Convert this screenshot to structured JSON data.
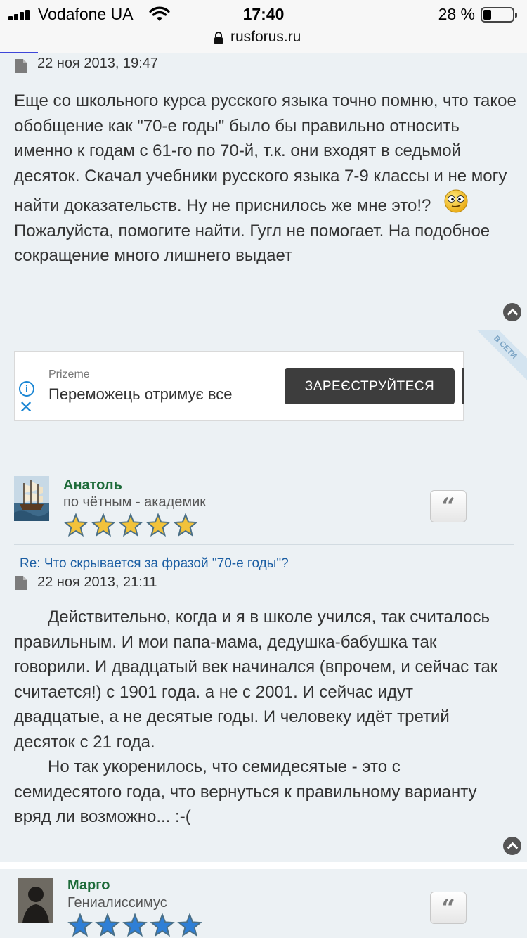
{
  "status_bar": {
    "carrier": "Vodafone UA",
    "time": "17:40",
    "battery_percent": "28 %",
    "battery_level": 0.28
  },
  "address_bar": {
    "url": "rusforus.ru"
  },
  "post1": {
    "date": "22 ноя 2013, 19:47",
    "text_before_emoji": "Еще со школьного курса русского языка точно помню, что такое обобщение как \"70-е годы\" было бы правильно относить именно к годам с 61-го по 70-й, т.к. они входят в седьмой десяток. Скачал учебники русского языка 7-9 классы и не могу найти доказательств. Ну не приснилось же мне это!?",
    "text_after_emoji": "Пожалуйста, помогите найти. Гугл не помогает. На подобное сокращение много лишнего выдает"
  },
  "ad": {
    "brand": "Prizeme",
    "headline": "Переможець отримує все",
    "cta": "ЗАРЕЄСТРУЙТЕСЯ",
    "corner_label": "В СЕТИ"
  },
  "post2": {
    "author_name": "Анатоль",
    "author_rank": "по чётным - академик",
    "rating_stars": 5,
    "subject": "Re: Что скрывается за фразой \"70-е годы\"?",
    "date": "22 ноя 2013, 21:11",
    "paragraph1": "Действительно, когда и я в школе учился, так считалось правильным. И мои папа-мама, дедушка-бабушка так говорили. И двадцатый век начинался (впрочем, и сейчас так считается!) с 1901 года. а не с 2001. И сейчас идут двадцатые, а не десятые годы. И человеку идёт третий десяток с 21 года.",
    "paragraph2": "Но так укоренилось, что семидесятые - это с семидесятого года, что вернуться к правильному варианту вряд ли возможно... :-("
  },
  "post3": {
    "author_name": "Марго",
    "author_rank": "Гениалиссимус",
    "rating_stars": 5
  },
  "colors": {
    "post_background": "#ecf1f4",
    "author_name": "#1e6b3a",
    "subject_link": "#1b5ea3",
    "gold_star": "#f2c23a",
    "blue_star": "#2f7fd6"
  }
}
